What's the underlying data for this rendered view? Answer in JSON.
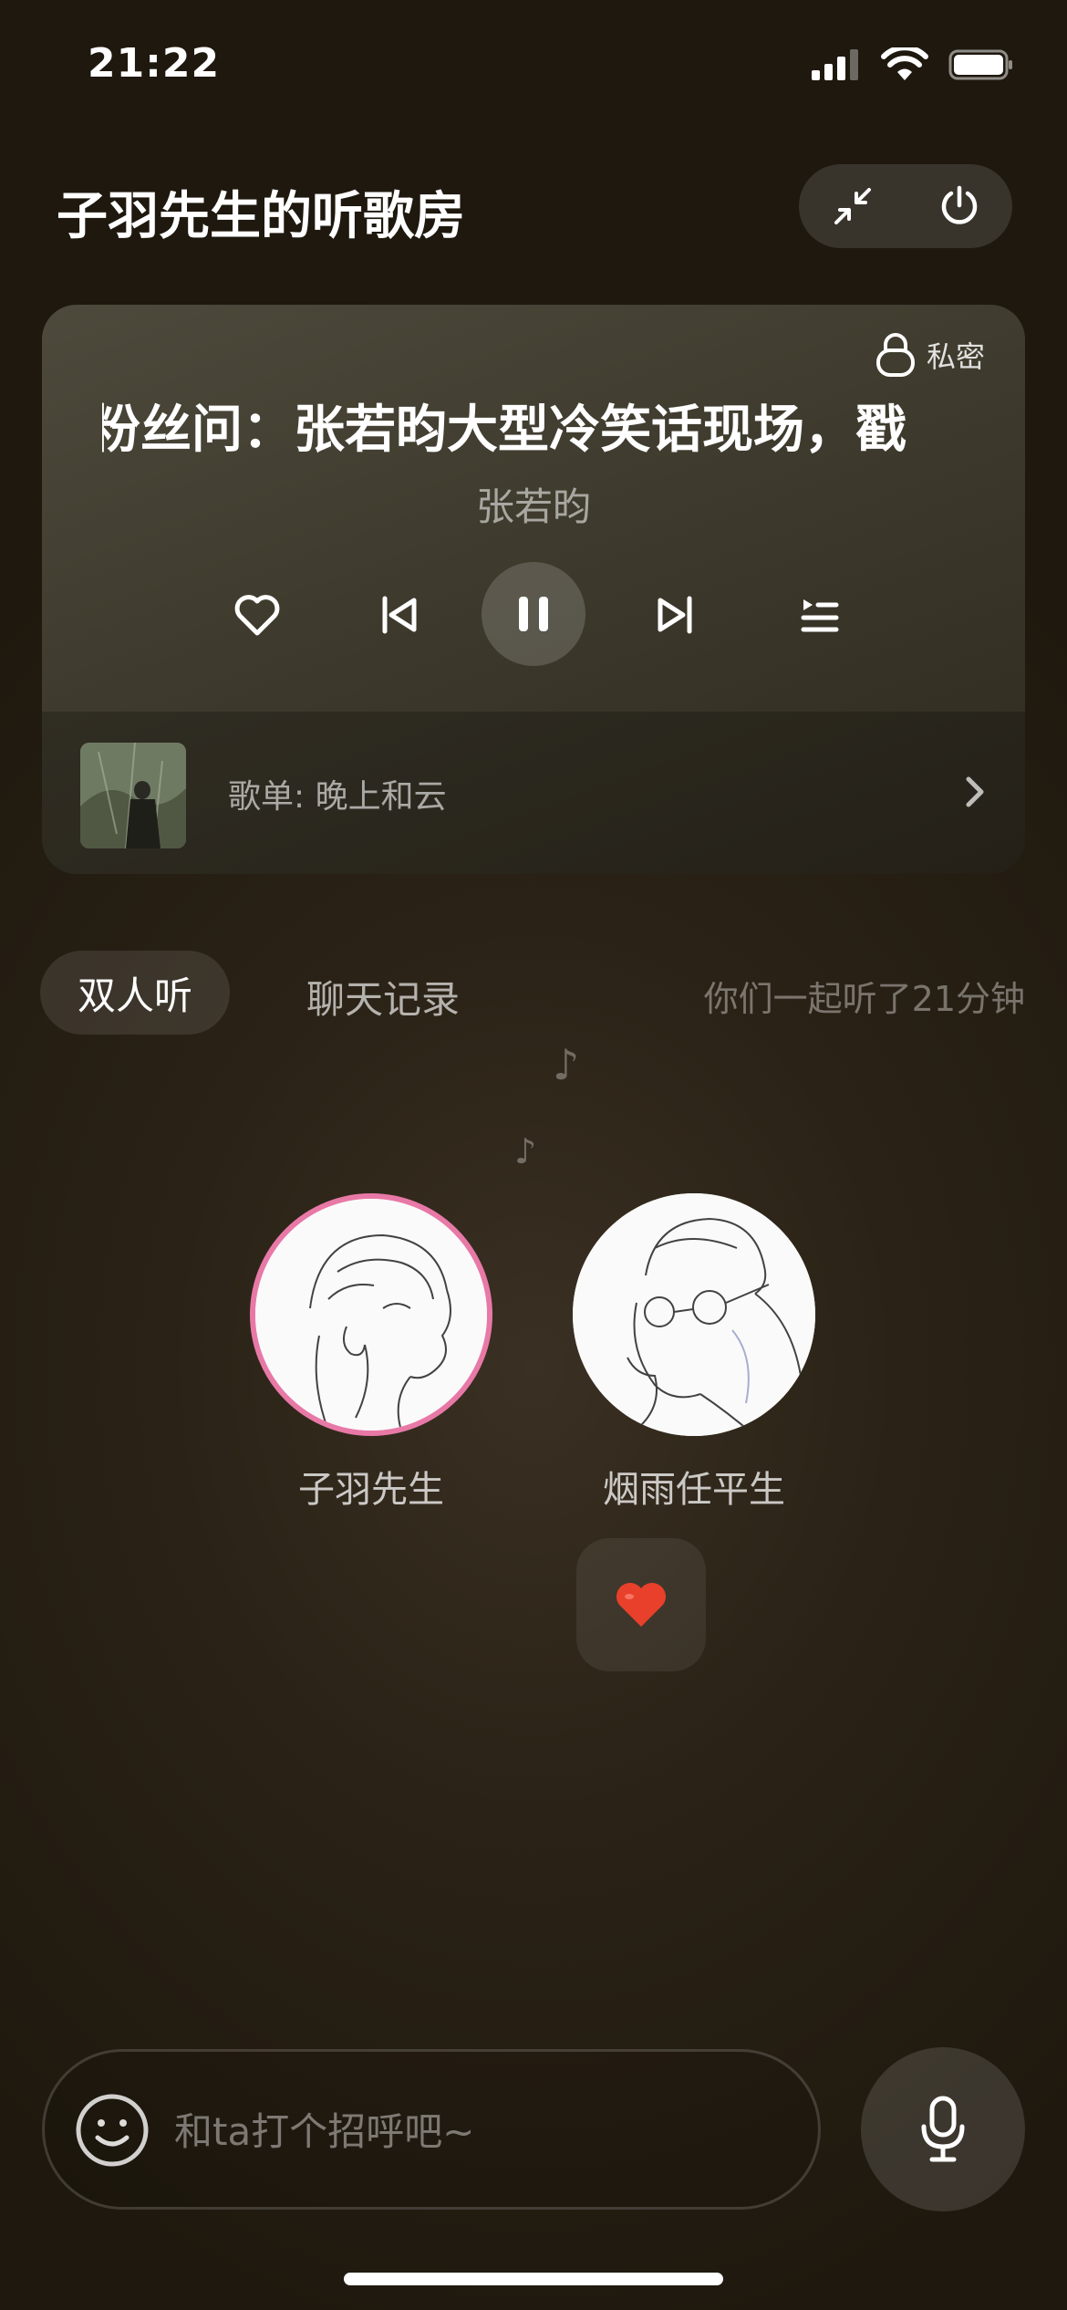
{
  "status_bar": {
    "time": "21:22"
  },
  "header": {
    "title": "子羽先生的听歌房"
  },
  "player": {
    "private_label": "私密",
    "song_title": "粉丝问：张若昀大型冷笑话现场，戳",
    "artist": "张若昀",
    "playlist_label": "歌单: 晚上和云"
  },
  "tabs": {
    "duo": "双人听",
    "chat_history": "聊天记录"
  },
  "listen_duration": "你们一起听了21分钟",
  "users": {
    "me": "子羽先生",
    "partner": "烟雨任平生"
  },
  "chat": {
    "placeholder": "和ta打个招呼吧~"
  },
  "colors": {
    "avatar_ring": "#e879a7",
    "heart": "#e8402a"
  },
  "icons": [
    "collapse-icon",
    "power-icon",
    "lock-icon",
    "heart-outline-icon",
    "previous-icon",
    "pause-icon",
    "next-icon",
    "queue-list-icon",
    "chevron-right-icon",
    "music-note-icon",
    "heart-icon",
    "emoji-icon",
    "mic-icon"
  ]
}
